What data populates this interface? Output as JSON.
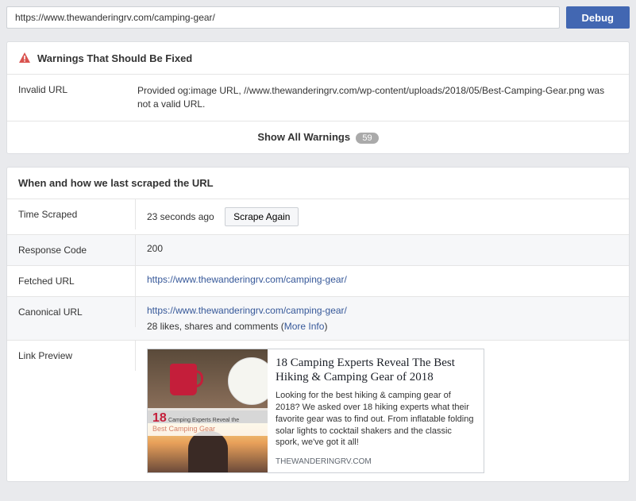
{
  "topbar": {
    "url_value": "https://www.thewanderingrv.com/camping-gear/",
    "debug_label": "Debug"
  },
  "warnings": {
    "header": "Warnings That Should Be Fixed",
    "items": [
      {
        "label": "Invalid URL",
        "message": "Provided og:image URL, //www.thewanderingrv.com/wp-content/uploads/2018/05/Best-Camping-Gear.png was not a valid URL."
      }
    ],
    "show_all_label": "Show All Warnings",
    "show_all_count": "59"
  },
  "scrape": {
    "header": "When and how we last scraped the URL",
    "rows": {
      "time_scraped": {
        "label": "Time Scraped",
        "value": "23 seconds ago",
        "button": "Scrape Again"
      },
      "response_code": {
        "label": "Response Code",
        "value": "200"
      },
      "fetched_url": {
        "label": "Fetched URL",
        "value": "https://www.thewanderingrv.com/camping-gear/"
      },
      "canonical_url": {
        "label": "Canonical URL",
        "value": "https://www.thewanderingrv.com/camping-gear/",
        "sub_text": "28 likes, shares and comments (",
        "more_info": "More Info",
        "close": ")"
      },
      "link_preview": {
        "label": "Link Preview"
      }
    }
  },
  "preview": {
    "title": "18 Camping Experts Reveal The Best Hiking & Camping Gear of 2018",
    "description": "Looking for the best hiking & camping gear of 2018? We asked over 18 hiking experts what their favorite gear was to find out. From inflatable folding solar lights to cocktail shakers and the classic spork, we've got it all!",
    "domain": "THEWANDERINGRV.COM",
    "img_overlay": {
      "num": "18",
      "rest": "Camping Experts Reveal the",
      "bcg": "Best Camping Gear"
    }
  }
}
